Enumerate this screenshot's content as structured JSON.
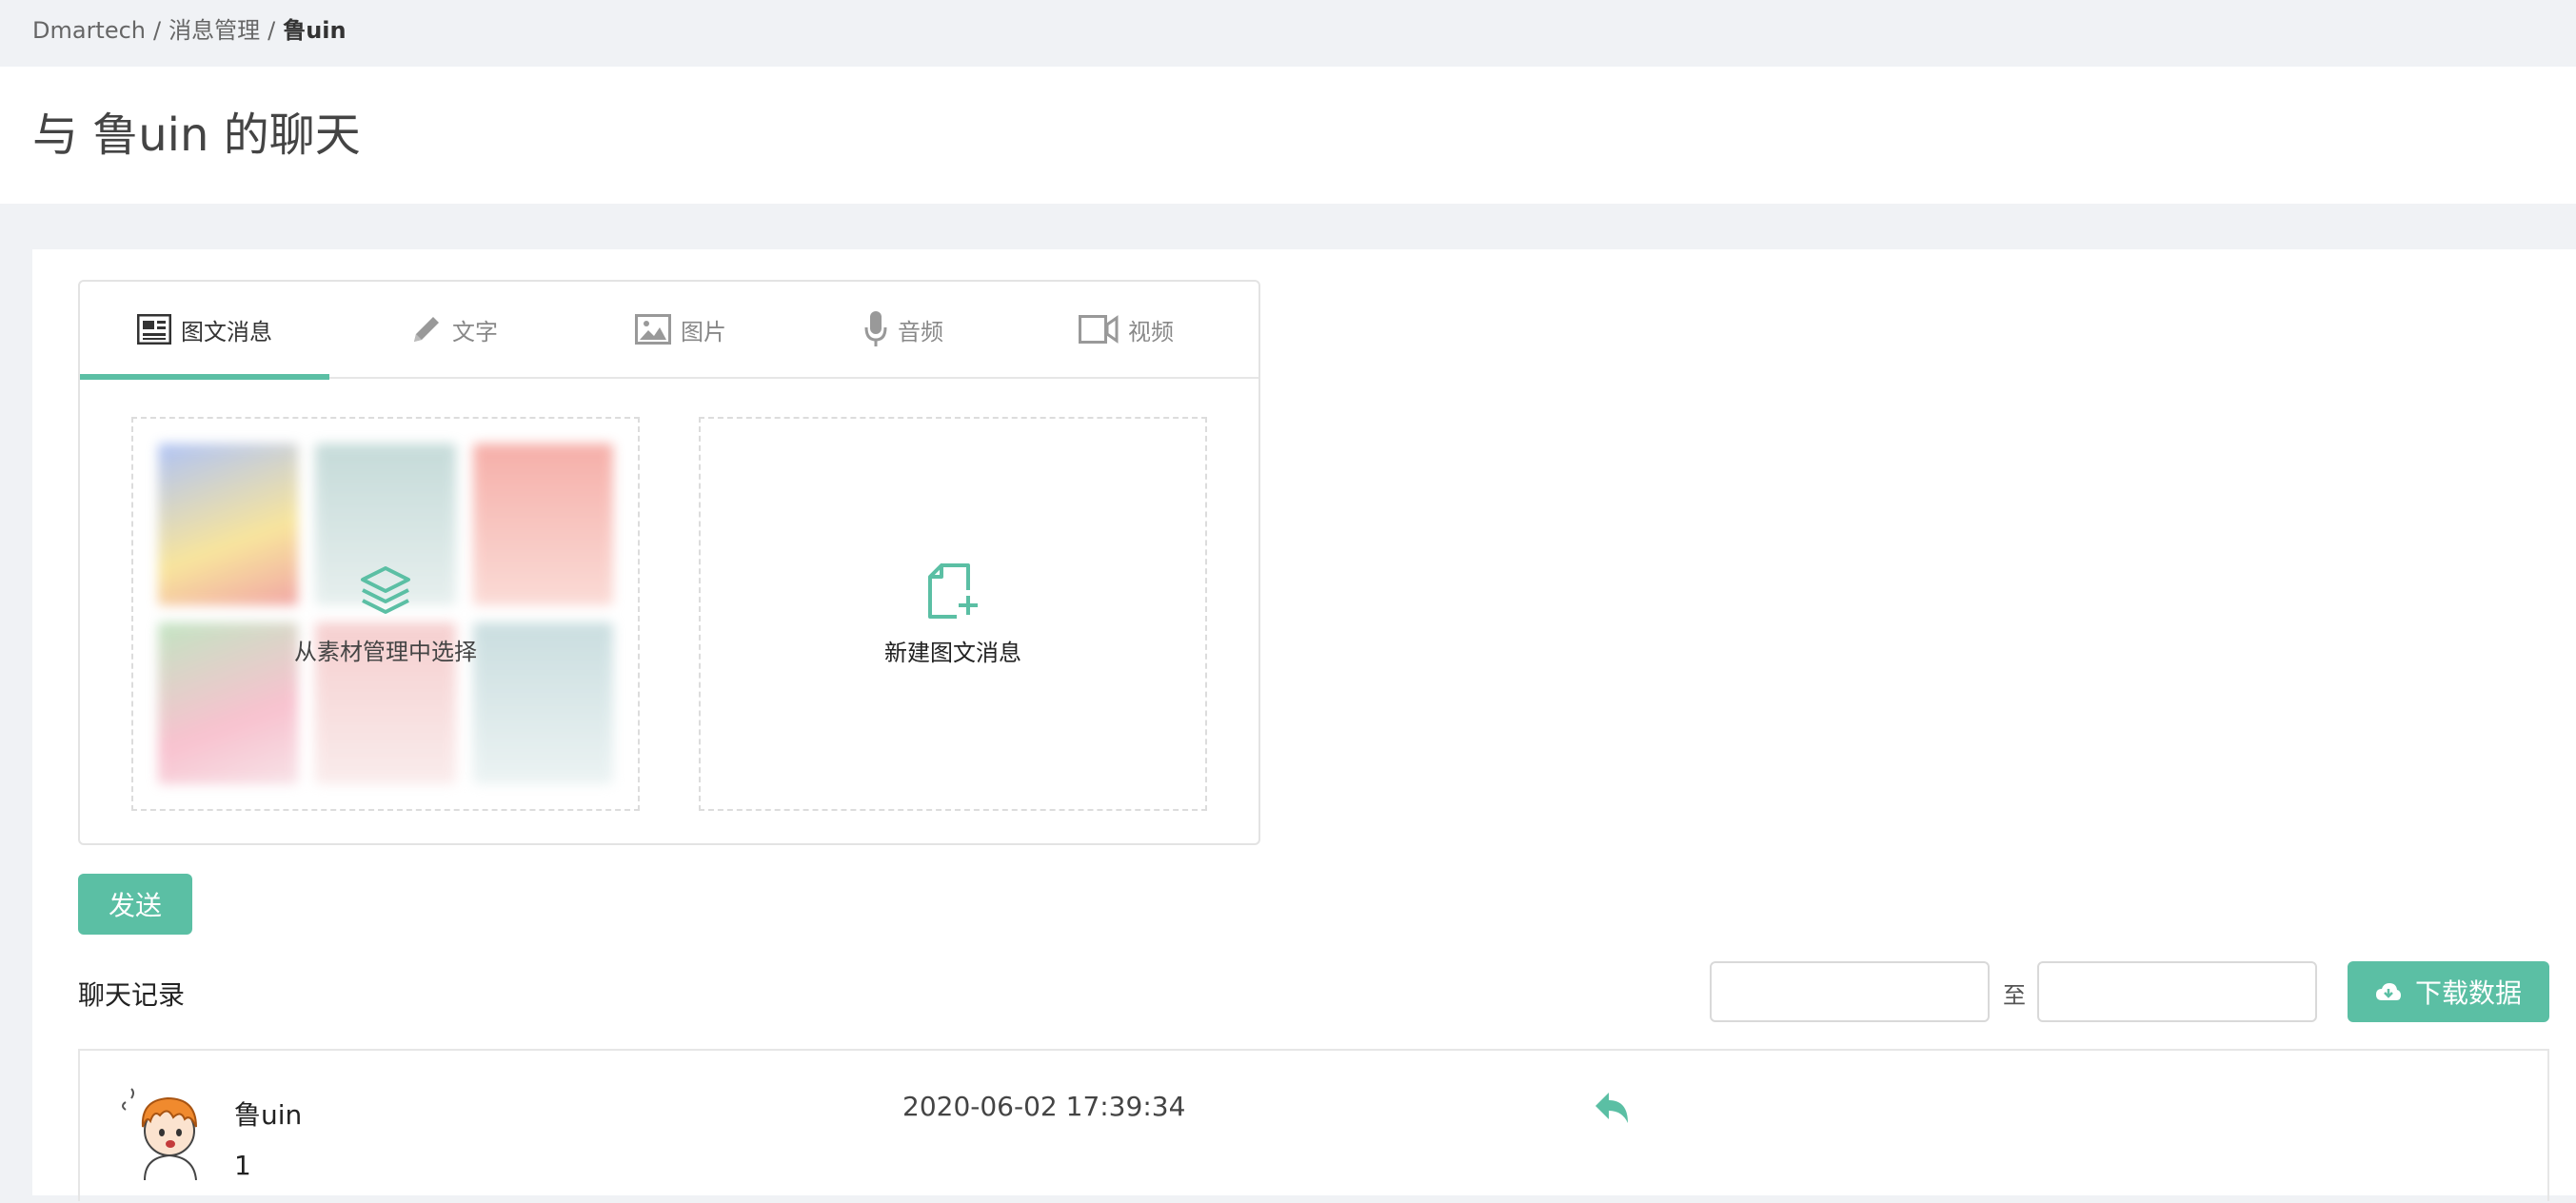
{
  "breadcrumb": {
    "items": [
      "Dmartech",
      "消息管理"
    ],
    "current": "鲁uin",
    "separator": "/"
  },
  "page": {
    "title": "与 鲁uin 的聊天"
  },
  "composer": {
    "tabs": [
      {
        "label": "图文消息",
        "icon": "newspaper-icon",
        "active": true
      },
      {
        "label": "文字",
        "icon": "pencil-icon",
        "active": false
      },
      {
        "label": "图片",
        "icon": "image-icon",
        "active": false
      },
      {
        "label": "音频",
        "icon": "microphone-icon",
        "active": false
      },
      {
        "label": "视频",
        "icon": "video-camera-icon",
        "active": false
      }
    ],
    "select_from_library_label": "从素材管理中选择",
    "new_article_label": "新建图文消息",
    "send_label": "发送"
  },
  "history": {
    "title": "聊天记录",
    "date_separator": "至",
    "start_date_value": "",
    "end_date_value": "",
    "download_label": "下载数据",
    "messages": [
      {
        "name": "鲁uin",
        "content": "1",
        "time": "2020-06-02 17:39:34"
      }
    ]
  },
  "colors": {
    "accent": "#5bbfa4",
    "background": "#f0f2f5",
    "card": "#ffffff",
    "border": "#e3e3e3"
  }
}
